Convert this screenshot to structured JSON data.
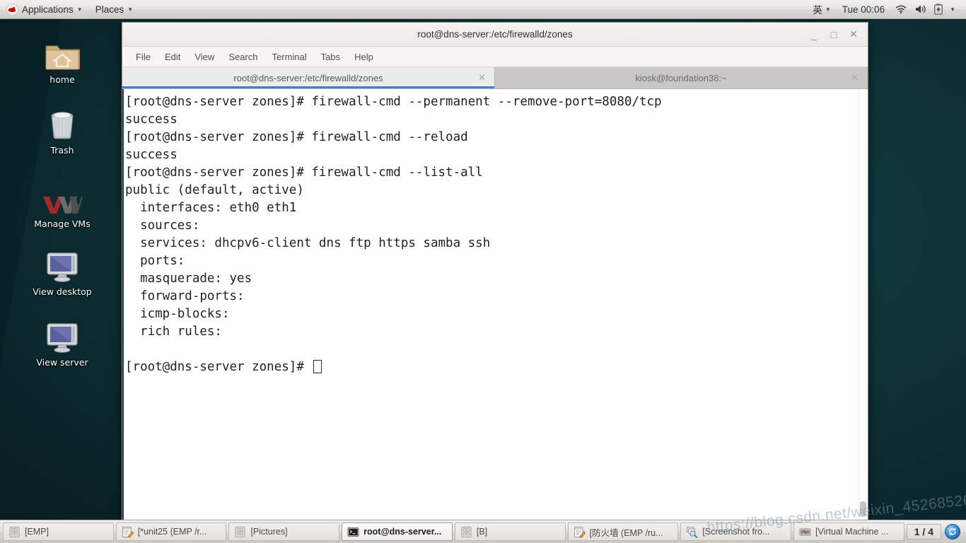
{
  "top_panel": {
    "logo_icon": "redhat-logo-icon",
    "applications_label": "Applications",
    "places_label": "Places",
    "input_method": "英",
    "clock": "Tue 00:06",
    "tray_icons": [
      "wifi-icon",
      "volume-icon",
      "battery-icon",
      "chevron-down-icon"
    ]
  },
  "desktop_icons": [
    {
      "label": "home",
      "icon": "home-folder-icon"
    },
    {
      "label": "Trash",
      "icon": "trash-can-icon"
    },
    {
      "label": "Manage VMs",
      "icon": "vmware-logo-icon"
    },
    {
      "label": "View desktop",
      "icon": "monitor-icon"
    },
    {
      "label": "View server",
      "icon": "monitor-icon"
    }
  ],
  "terminal": {
    "window_title": "root@dns-server:/etc/firewalld/zones",
    "window_controls": {
      "minimize": "_",
      "maximize": "□",
      "close": "✕"
    },
    "menu": [
      "File",
      "Edit",
      "View",
      "Search",
      "Terminal",
      "Tabs",
      "Help"
    ],
    "tabs": [
      {
        "label": "root@dns-server:/etc/firewalld/zones",
        "active": true,
        "close": "✕"
      },
      {
        "label": "kiosk@foundation38:~",
        "active": false,
        "close": "✕"
      }
    ],
    "content": "[root@dns-server zones]# firewall-cmd --permanent --remove-port=8080/tcp\nsuccess\n[root@dns-server zones]# firewall-cmd --reload\nsuccess\n[root@dns-server zones]# firewall-cmd --list-all\npublic (default, active)\n  interfaces: eth0 eth1\n  sources:\n  services: dhcpv6-client dns ftp https samba ssh\n  ports:\n  masquerade: yes\n  forward-ports:\n  icmp-blocks:\n  rich rules:\n\n[root@dns-server zones]# ",
    "prompt_cursor": "block-cursor"
  },
  "taskbar": {
    "items": [
      {
        "label": "[EMP]",
        "icon": "archive-icon",
        "active": false
      },
      {
        "label": "[*unit25 (EMP /r...",
        "icon": "notepad-edit-icon",
        "active": false
      },
      {
        "label": "[Pictures]",
        "icon": "archive-icon",
        "active": false
      },
      {
        "label": "root@dns-server...",
        "icon": "terminal-icon",
        "active": true
      },
      {
        "label": "[B]",
        "icon": "archive-icon",
        "active": false
      },
      {
        "label": "[防火墙 (EMP /ru...",
        "icon": "notepad-edit-icon",
        "active": false
      },
      {
        "label": "[Screenshot fro...",
        "icon": "screenshot-icon",
        "active": false
      },
      {
        "label": "[Virtual Machine ...",
        "icon": "vm-icon",
        "active": false
      }
    ],
    "workspace_indicator": "1 / 4",
    "workspace_switcher_icon": "workspace-switcher-icon"
  },
  "watermark": "https://blog.csdn.net/weixin_45268526",
  "colors": {
    "accent_blue": "#3584e4",
    "desktop_bg": "#0c3135",
    "panel_bg": "#e6e4e1",
    "terminal_fg": "#1b2226",
    "terminal_bg": "#ffffff"
  }
}
